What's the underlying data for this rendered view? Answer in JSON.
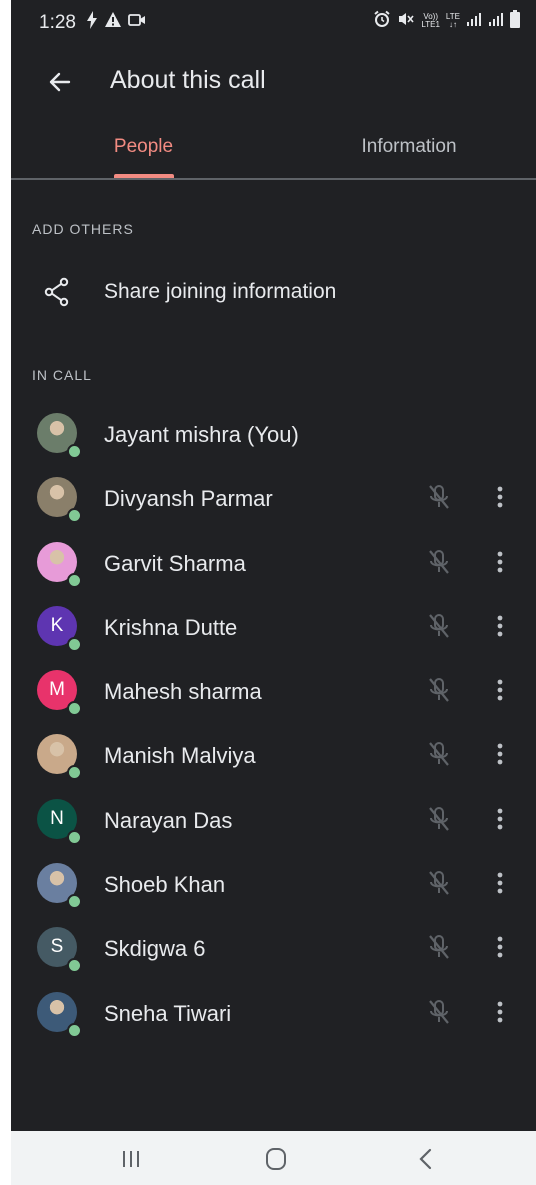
{
  "status_bar": {
    "time": "1:28",
    "left_icons": [
      "flash-icon",
      "warning-icon",
      "video-icon"
    ],
    "right_icons": [
      "alarm-icon",
      "mute-icon",
      "volte-icon",
      "signal-icon",
      "signal-icon",
      "battery-icon"
    ],
    "volte_top": "Vo))",
    "volte_bottom": "LTE1",
    "lte_top": "LTE",
    "lte_bottom": "↓↑"
  },
  "header": {
    "title": "About this call",
    "back_icon": "arrow-back-icon"
  },
  "tabs": [
    {
      "label": "People",
      "active": true
    },
    {
      "label": "Information",
      "active": false
    }
  ],
  "add_others": {
    "header": "ADD OTHERS",
    "share_label": "Share joining information",
    "share_icon": "share-icon"
  },
  "in_call": {
    "header": "IN CALL",
    "participants": [
      {
        "name": "Jayant mishra (You)",
        "avatar": "photo",
        "avatar_color": "#6b7d6a",
        "initial": "",
        "muted_icon": false
      },
      {
        "name": "Divyansh Parmar",
        "avatar": "photo",
        "avatar_color": "#8a7f6a",
        "initial": "",
        "muted_icon": true
      },
      {
        "name": "Garvit Sharma",
        "avatar": "photo",
        "avatar_color": "#e79bd8",
        "initial": "",
        "muted_icon": true
      },
      {
        "name": "Krishna Dutte",
        "avatar": "initial",
        "avatar_color": "#5e35b1",
        "initial": "K",
        "muted_icon": true
      },
      {
        "name": "Mahesh sharma",
        "avatar": "initial",
        "avatar_color": "#e8336b",
        "initial": "M",
        "muted_icon": true
      },
      {
        "name": "Manish Malviya",
        "avatar": "photo",
        "avatar_color": "#c9a98a",
        "initial": "",
        "muted_icon": true
      },
      {
        "name": "Narayan Das",
        "avatar": "initial",
        "avatar_color": "#0b5345",
        "initial": "N",
        "muted_icon": true
      },
      {
        "name": "Shoeb Khan",
        "avatar": "photo",
        "avatar_color": "#6a7fa0",
        "initial": "",
        "muted_icon": true
      },
      {
        "name": "Skdigwa 6",
        "avatar": "initial",
        "avatar_color": "#455a64",
        "initial": "S",
        "muted_icon": true
      },
      {
        "name": "Sneha Tiwari",
        "avatar": "photo",
        "avatar_color": "#3d5a78",
        "initial": "",
        "muted_icon": true
      }
    ]
  },
  "colors": {
    "background": "#202124",
    "accent": "#f28b82",
    "online": "#81c995",
    "text": "#e8eaed",
    "secondary_text": "#bdc1c6"
  },
  "nav_bar": {
    "buttons": [
      "recent-apps-icon",
      "home-icon",
      "back-icon"
    ]
  }
}
